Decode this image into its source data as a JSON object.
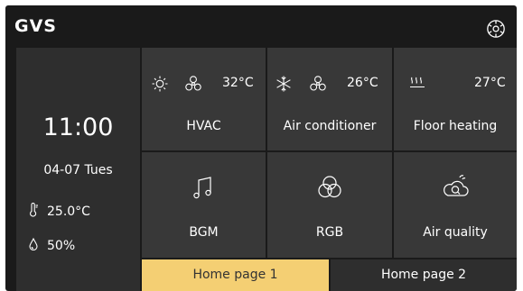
{
  "header": {
    "logo": "GVS",
    "settings_icon": "settings-gear-icon"
  },
  "clock": {
    "time": "11:00",
    "date": "04-07  Tues"
  },
  "environment": {
    "temperature": "25.0°C",
    "humidity": "50%",
    "temperature_icon": "thermometer-icon",
    "humidity_icon": "water-drop-icon"
  },
  "tiles": [
    {
      "label": "HVAC",
      "value": "32°C",
      "icons": [
        "sun-icon",
        "fan-icon"
      ]
    },
    {
      "label": "Air conditioner",
      "value": "26°C",
      "icons": [
        "snowflake-icon",
        "fan-icon"
      ]
    },
    {
      "label": "Floor heating",
      "value": "27°C",
      "icons": [
        "heat-waves-icon"
      ]
    },
    {
      "label": "BGM",
      "icons": [
        "music-note-icon"
      ]
    },
    {
      "label": "RGB",
      "icons": [
        "rgb-circles-icon"
      ]
    },
    {
      "label": "Air quality",
      "icons": [
        "cloud-search-icon"
      ]
    }
  ],
  "tabs": [
    {
      "label": "Home page 1",
      "active": true
    },
    {
      "label": "Home page 2",
      "active": false
    }
  ],
  "colors": {
    "background": "#1a1a1a",
    "panel": "#2e2e2e",
    "tile": "#383838",
    "active_tab": "#f4cf73"
  }
}
